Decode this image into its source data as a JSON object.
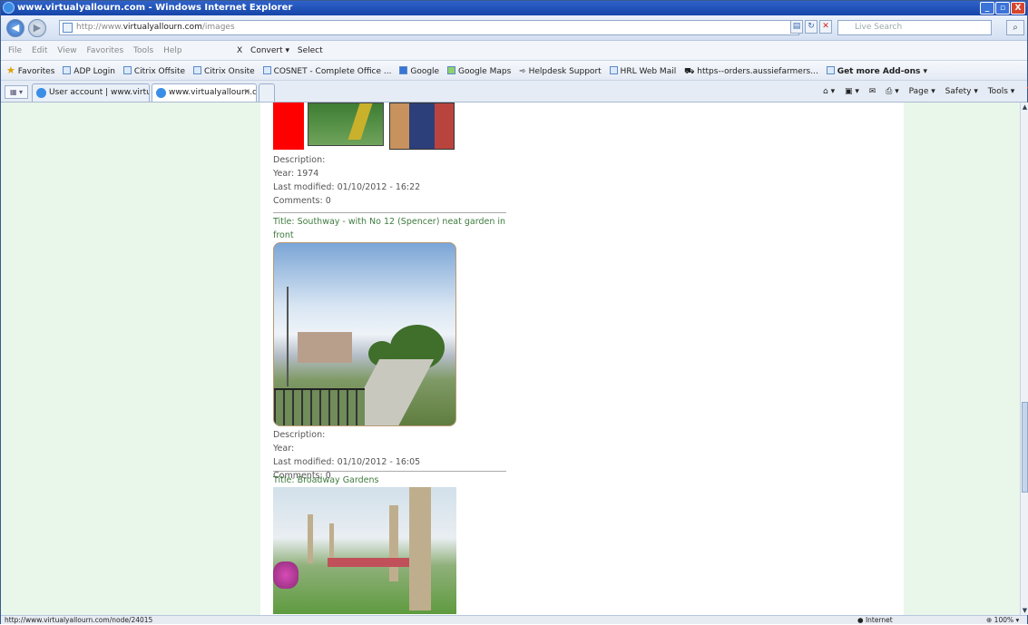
{
  "window": {
    "title": "www.virtualyallourn.com - Windows Internet Explorer",
    "minimize": "_",
    "maximize": "▫",
    "close": "X"
  },
  "address_bar": {
    "url_prefix": "http://www.",
    "url_domain": "virtualyallourn.com",
    "url_path": "/images",
    "search_placeholder": "Live Search"
  },
  "menu": [
    "File",
    "Edit",
    "View",
    "Favorites",
    "Tools",
    "Help"
  ],
  "toolbar": {
    "close": "X",
    "convert": "Convert ▾",
    "select": "Select"
  },
  "favorites_bar": {
    "favorites_label": "Favorites",
    "links": [
      "ADP Login",
      "Citrix Offsite",
      "Citrix Onsite",
      "COSNET - Complete Office ...",
      "Google",
      "Google Maps",
      "Helpdesk Support",
      "HRL Web Mail",
      "https--orders.aussiefarmers...",
      "Get more Add-ons ▾"
    ]
  },
  "tabs": [
    {
      "label": "User account | www.virtualy..."
    },
    {
      "label": "www.virtualyallourn.com"
    }
  ],
  "command_bar": [
    "Page ▾",
    "Safety ▾",
    "Tools ▾"
  ],
  "nodes": [
    {
      "title": "",
      "description": "Description:",
      "year": "Year: 1974",
      "modified": "Last modified: 01/10/2012 - 16:22",
      "comments": "Comments: 0"
    },
    {
      "title": "Title: Southway - with No 12 (Spencer) neat garden in front",
      "description": "Description:",
      "year": "Year:",
      "modified": "Last modified: 01/10/2012 - 16:05",
      "comments": "Comments: 0"
    },
    {
      "title": "Title: Broadway Gardens"
    }
  ],
  "status_bar": {
    "url": "http://www.virtualyallourn.com/node/24015",
    "zone": "Internet",
    "zoom": "100%"
  }
}
